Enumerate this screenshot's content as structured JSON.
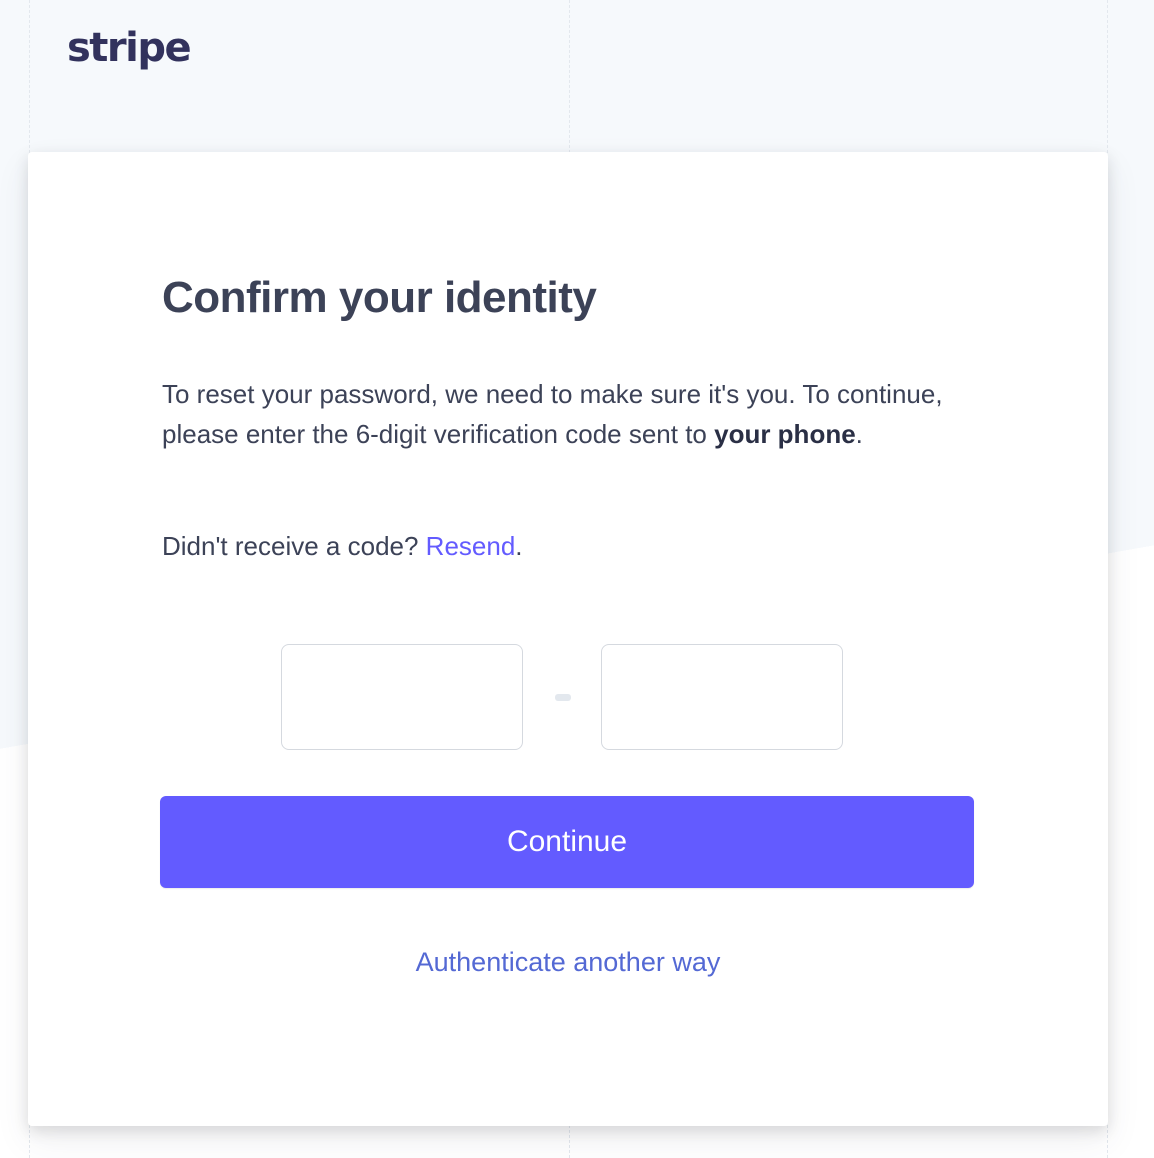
{
  "brand": {
    "logo_text": "stripe",
    "accent_color": "#635bff"
  },
  "card": {
    "title": "Confirm your identity",
    "description_prefix": "To reset your password, we need to make sure it's you. To continue, please enter the 6-digit verification code sent to ",
    "description_target": "your phone",
    "description_suffix": ".",
    "resend_prompt": "Didn't receive a code? ",
    "resend_link": "Resend",
    "resend_suffix": ".",
    "code": {
      "digits": 6,
      "values": [
        "",
        "",
        "",
        "",
        "",
        ""
      ]
    },
    "continue_label": "Continue",
    "alt_auth_label": "Authenticate another way"
  }
}
